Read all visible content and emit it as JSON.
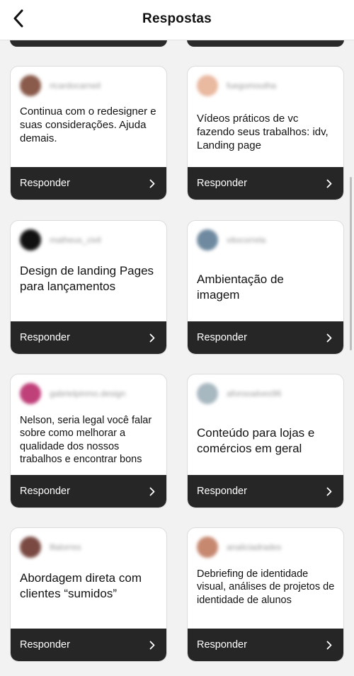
{
  "header": {
    "title": "Respostas",
    "back_icon": "chevron-left-icon"
  },
  "reply_label": "Responder",
  "cards": [
    {
      "username": "ricardocarneil",
      "avatar_color": "#8a5a4a",
      "question": "Continua com o redesigner e suas considerações. Ajuda demais."
    },
    {
      "username": "fuegomoutha",
      "avatar_color": "#e9b9a0",
      "question": "Vídeos práticos de vc fazendo seus trabalhos: idv, Landing page"
    },
    {
      "username": "matheus_civil",
      "avatar_color": "#111111",
      "question": "Design de landing Pages para lançamentos"
    },
    {
      "username": "vitocorrela",
      "avatar_color": "#6f8aa0",
      "question": "Ambientação de imagem"
    },
    {
      "username": "gabrielpinmo.design",
      "avatar_color": "#c0407a",
      "question": "Nelson, seria legal você falar sobre como melhorar a qualidade dos nossos trabalhos e encontrar bons"
    },
    {
      "username": "afonsoalves96",
      "avatar_color": "#a8b8c0",
      "question": "Conteúdo para lojas e comércios em geral"
    },
    {
      "username": "lllalorres",
      "avatar_color": "#7a4a42",
      "question": "Abordagem direta com clientes “sumidos”"
    },
    {
      "username": "analiciadrades",
      "avatar_color": "#c78870",
      "question": "Debriefing de identidade visual, análises de projetos de identidade de alunos"
    }
  ]
}
